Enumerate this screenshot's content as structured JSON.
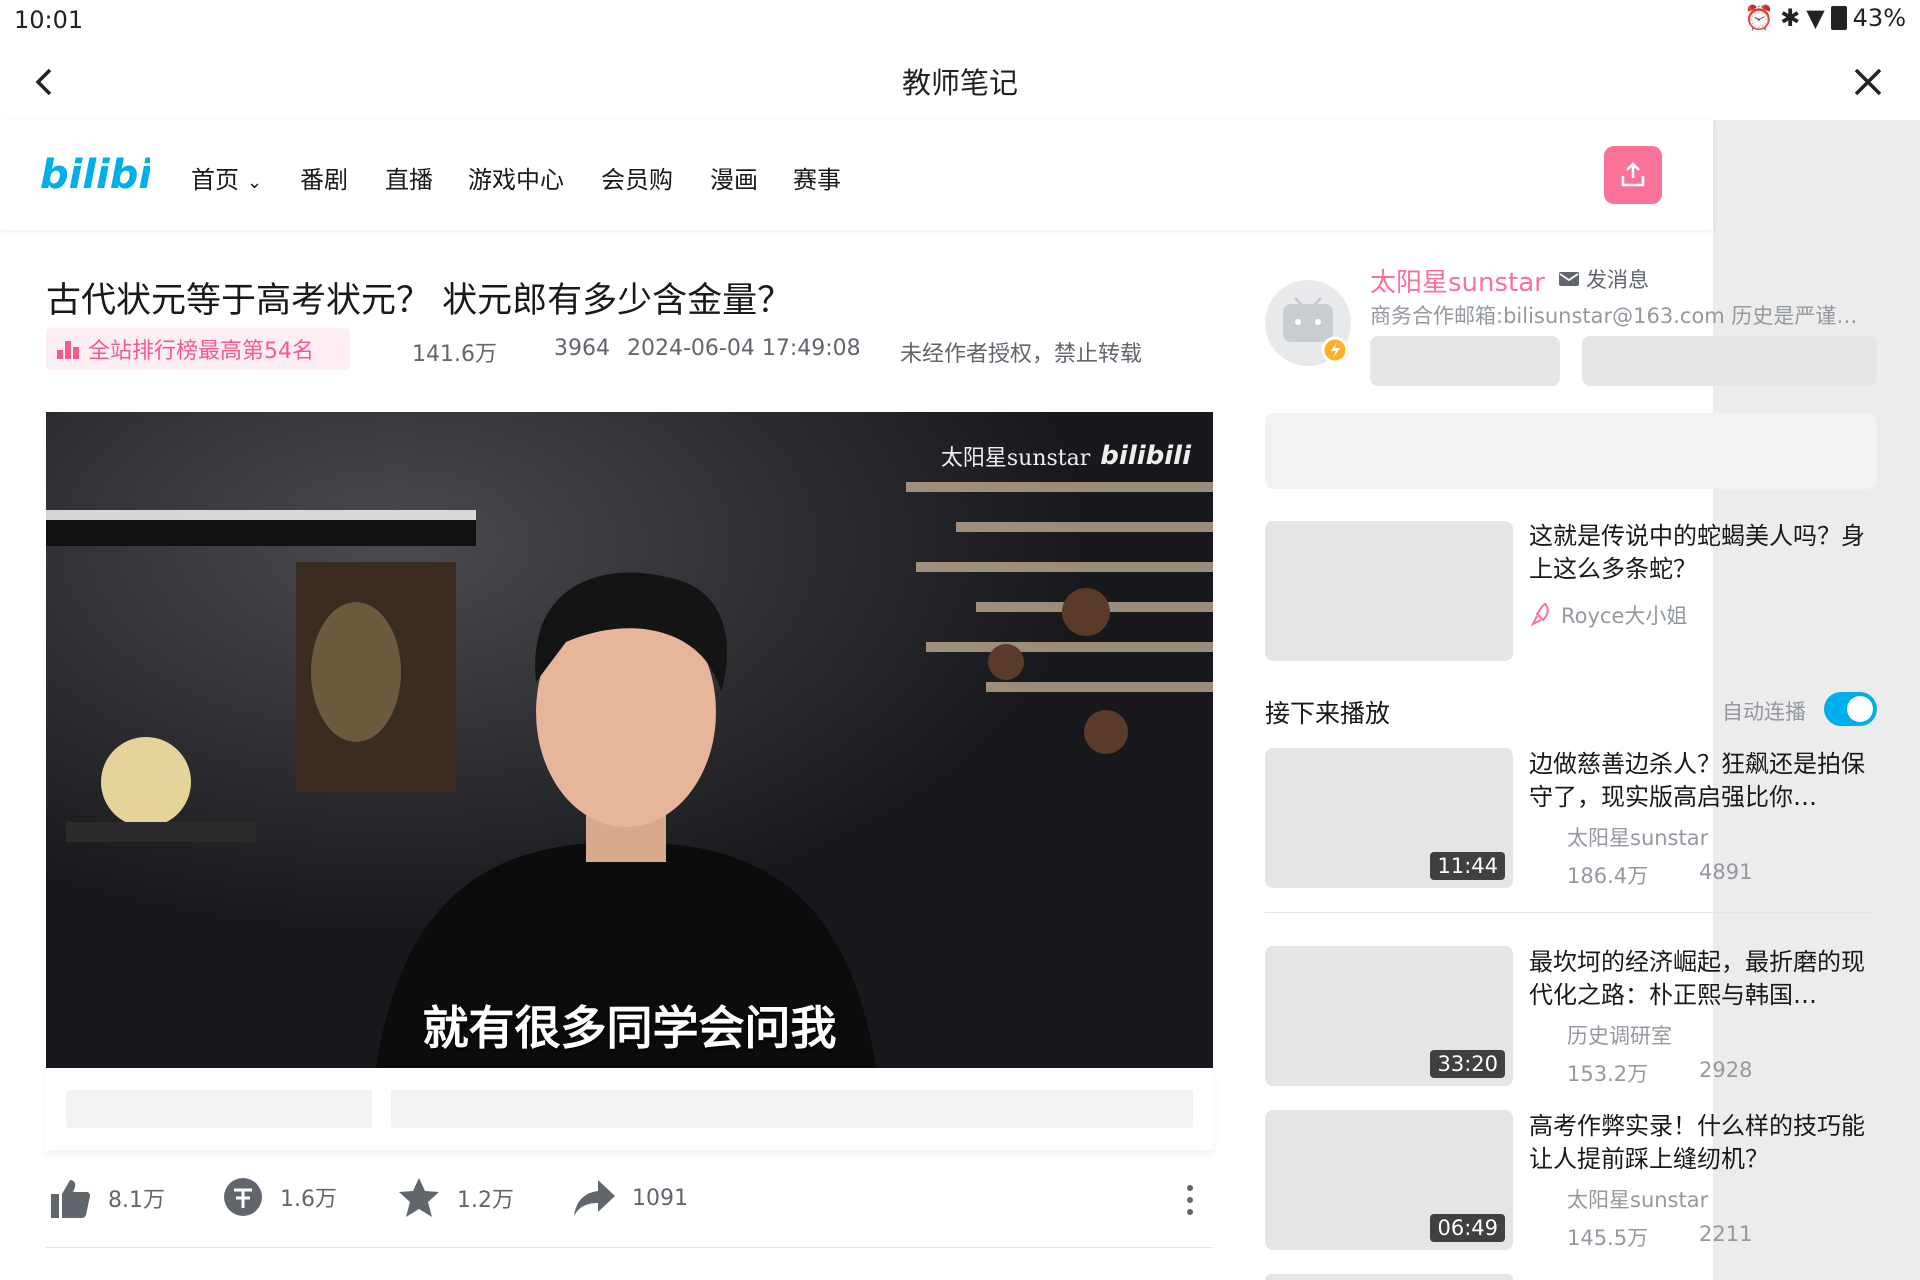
{
  "status": {
    "time": "10:01",
    "battery": "43%"
  },
  "app": {
    "title": "教师笔记"
  },
  "nav": {
    "items": [
      "首页",
      "番剧",
      "直播",
      "游戏中心",
      "会员购",
      "漫画",
      "赛事"
    ]
  },
  "video": {
    "title": "古代状元等于高考状元？ 状元郎有多少含金量？",
    "rank": "全站排行榜最高第54名",
    "views": "141.6万",
    "danmaku": "3964",
    "date": "2024-06-04 17:49:08",
    "copyright": "未经作者授权，禁止转载",
    "subtitle": "就有很多同学会问我",
    "watermark": "太阳星sunstar"
  },
  "actions": {
    "likes": "8.1万",
    "coins": "1.6万",
    "favorites": "1.2万",
    "shares": "1091"
  },
  "author": {
    "name": "太阳星sunstar",
    "message_label": "发消息",
    "desc": "商务合作邮箱:bilisunstar@163.com 历史是严谨…"
  },
  "top_rec": {
    "title": "这就是传说中的蛇蝎美人吗？身上这么多条蛇？",
    "author": "Royce大小姐"
  },
  "up_next": {
    "label": "接下来播放",
    "autoplay_label": "自动连播",
    "autoplay_on": true
  },
  "recommendations": [
    {
      "title": "边做慈善边杀人？狂飙还是拍保守了，现实版高启强比你…",
      "author": "太阳星sunstar",
      "views": "186.4万",
      "danmaku": "4891",
      "duration": "11:44"
    },
    {
      "title": "最坎坷的经济崛起，最折磨的现代化之路：朴正熙与韩国…",
      "author": "历史调研室",
      "views": "153.2万",
      "danmaku": "2928",
      "duration": "33:20"
    },
    {
      "title": "高考作弊实录！什么样的技巧能让人提前踩上缝纫机？",
      "author": "太阳星sunstar",
      "views": "145.5万",
      "danmaku": "2211",
      "duration": "06:49"
    }
  ],
  "colors": {
    "brand_pink": "#fb7299",
    "brand_blue": "#00aeec"
  },
  "icons": [
    "back-arrow-icon",
    "close-icon",
    "upload-icon",
    "rank-icon",
    "like-icon",
    "coin-icon",
    "favorite-icon",
    "share-icon",
    "more-icon",
    "mail-icon",
    "rocket-icon"
  ]
}
